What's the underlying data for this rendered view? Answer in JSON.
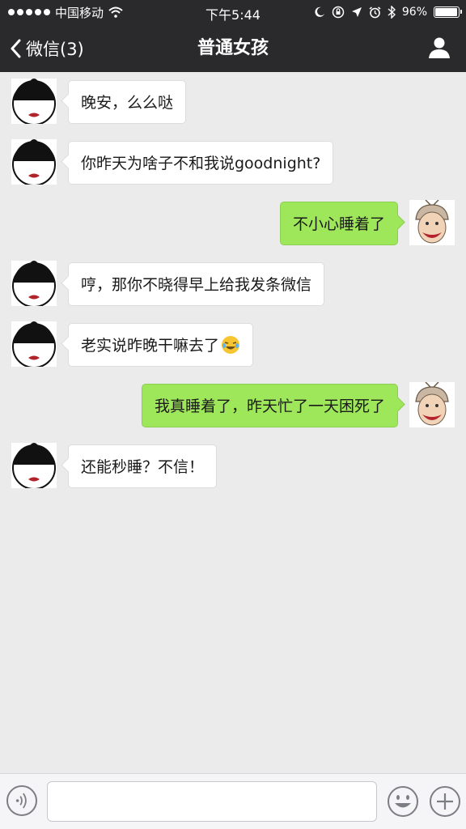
{
  "status_bar": {
    "carrier": "中国移动",
    "time": "下午5:44",
    "battery": "96%",
    "battery_level": 0.96
  },
  "nav": {
    "back_label": "微信(3)",
    "title": "普通女孩",
    "profile_icon": "person-icon"
  },
  "messages": [
    {
      "side": "in",
      "text": "晚安，么么哒"
    },
    {
      "side": "in",
      "text": "你昨天为啥子不和我说goodnight?"
    },
    {
      "side": "out",
      "text": "不小心睡着了"
    },
    {
      "side": "in",
      "text": "哼，那你不晓得早上给我发条微信"
    },
    {
      "side": "in",
      "text": "老实说昨晚干嘛去了",
      "emoji": "crying-laughing-emoji"
    },
    {
      "side": "out",
      "text": "我真睡着了，昨天忙了一天困死了"
    },
    {
      "side": "in",
      "text": "还能秒睡？不信！"
    }
  ],
  "input_bar": {
    "voice_icon": "voice-icon",
    "emoji_icon": "smiley-icon",
    "plus_icon": "plus-icon",
    "input_value": ""
  },
  "colors": {
    "nav_bg": "#2a2a2d",
    "chat_bg": "#ebebeb",
    "out_bubble": "#9ee65a",
    "in_bubble": "#ffffff"
  }
}
